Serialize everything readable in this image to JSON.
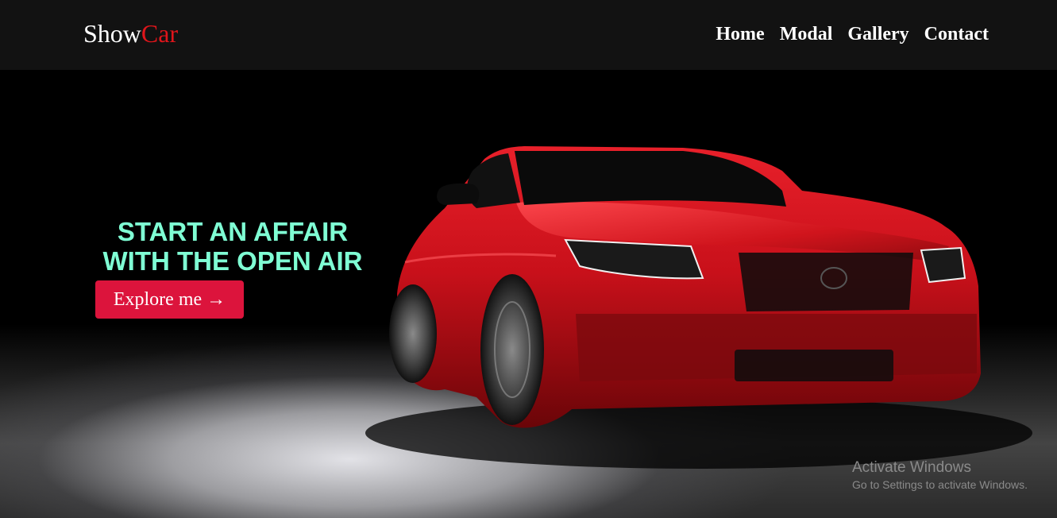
{
  "brand": {
    "name_part1": "Show",
    "name_part2": "Car"
  },
  "nav": {
    "items": [
      "Home",
      "Modal",
      "Gallery",
      "Contact"
    ]
  },
  "hero": {
    "headline_line1": "START AN AFFAIR",
    "headline_line2": "WITH THE OPEN AIR",
    "cta_label": "Explore me →"
  },
  "watermark": {
    "title": "Activate Windows",
    "subtitle": "Go to Settings to activate Windows."
  },
  "colors": {
    "navbar_bg": "#121212",
    "brand_accent": "#e0151b",
    "headline": "#7fffd4",
    "cta_bg": "#dc143c",
    "car_body": "#c8101a"
  }
}
